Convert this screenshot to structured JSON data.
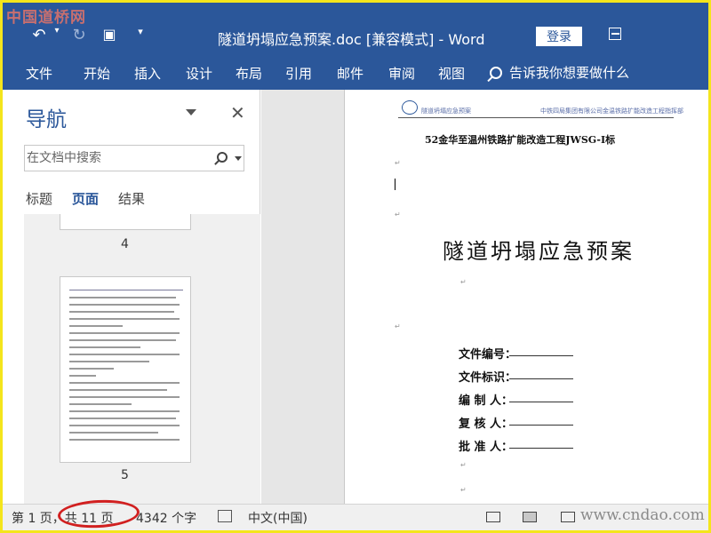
{
  "watermark_top": "中国道桥网",
  "title_bar": {
    "document_title": "隧道坍塌应急预案.doc [兼容模式]  -  Word",
    "login_label": "登录"
  },
  "ribbon": {
    "tabs": [
      "文件",
      "开始",
      "插入",
      "设计",
      "布局",
      "引用",
      "邮件",
      "审阅",
      "视图"
    ],
    "tell_me": "告诉我你想要做什么"
  },
  "nav_pane": {
    "title": "导航",
    "search_placeholder": "在文档中搜索",
    "tabs": [
      "标题",
      "页面",
      "结果"
    ],
    "active_tab": "页面",
    "page_numbers": [
      "4",
      "5"
    ]
  },
  "document": {
    "header_left": "隧道坍塌应急预案",
    "header_right": "中铁四局集团有限公司金温铁路扩能改造工程指挥部",
    "project_line": "52金华至温州铁路扩能改造工程JWSG-I标",
    "main_title": "隧道坍塌应急预案",
    "fields": [
      "文件编号：",
      "文件标识：",
      "编 制 人：",
      "复 核 人：",
      "批 准 人："
    ]
  },
  "status_bar": {
    "page_info": "第 1 页，共 11 页",
    "word_count": "4342 个字",
    "language": "中文(中国)",
    "watermark_bottom": "www.cndao.com"
  },
  "colors": {
    "word_blue": "#2b579a",
    "frame_yellow": "#f4e51c",
    "highlight_red": "#d12020"
  }
}
